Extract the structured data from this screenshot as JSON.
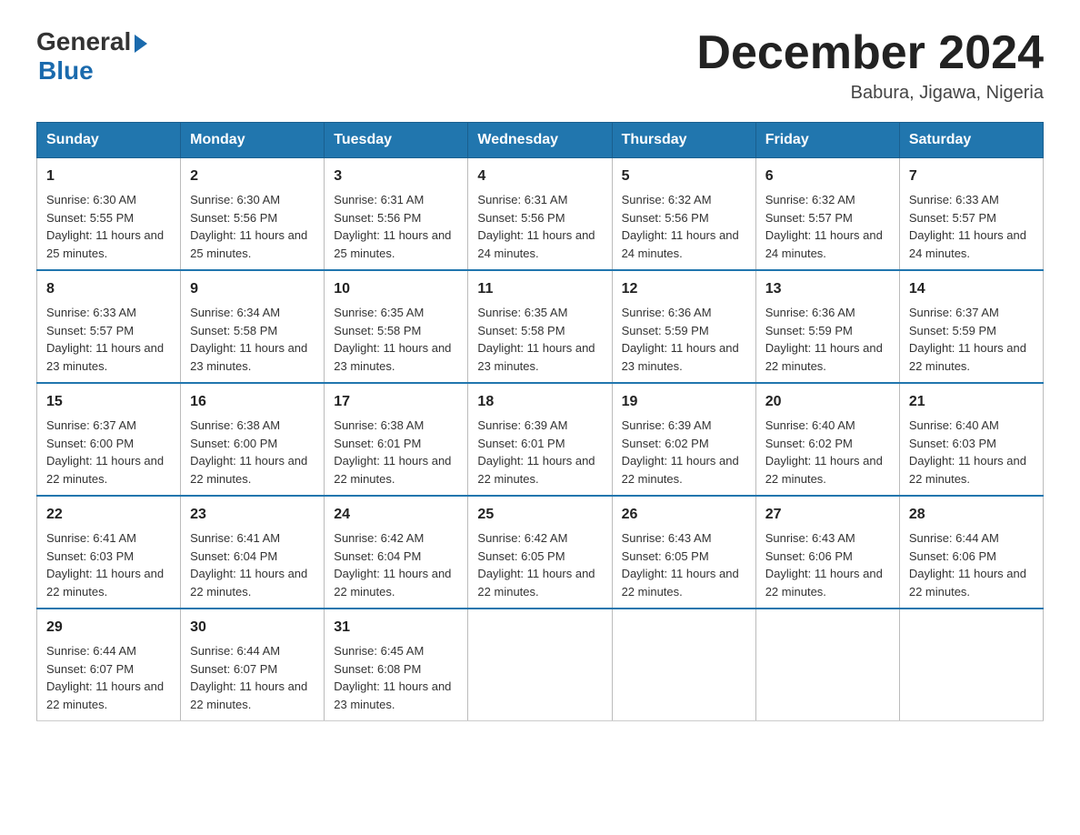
{
  "header": {
    "logo_general": "General",
    "logo_blue": "Blue",
    "month_title": "December 2024",
    "location": "Babura, Jigawa, Nigeria"
  },
  "weekdays": [
    "Sunday",
    "Monday",
    "Tuesday",
    "Wednesday",
    "Thursday",
    "Friday",
    "Saturday"
  ],
  "weeks": [
    [
      {
        "day": "1",
        "sunrise": "6:30 AM",
        "sunset": "5:55 PM",
        "daylight": "11 hours and 25 minutes."
      },
      {
        "day": "2",
        "sunrise": "6:30 AM",
        "sunset": "5:56 PM",
        "daylight": "11 hours and 25 minutes."
      },
      {
        "day": "3",
        "sunrise": "6:31 AM",
        "sunset": "5:56 PM",
        "daylight": "11 hours and 25 minutes."
      },
      {
        "day": "4",
        "sunrise": "6:31 AM",
        "sunset": "5:56 PM",
        "daylight": "11 hours and 24 minutes."
      },
      {
        "day": "5",
        "sunrise": "6:32 AM",
        "sunset": "5:56 PM",
        "daylight": "11 hours and 24 minutes."
      },
      {
        "day": "6",
        "sunrise": "6:32 AM",
        "sunset": "5:57 PM",
        "daylight": "11 hours and 24 minutes."
      },
      {
        "day": "7",
        "sunrise": "6:33 AM",
        "sunset": "5:57 PM",
        "daylight": "11 hours and 24 minutes."
      }
    ],
    [
      {
        "day": "8",
        "sunrise": "6:33 AM",
        "sunset": "5:57 PM",
        "daylight": "11 hours and 23 minutes."
      },
      {
        "day": "9",
        "sunrise": "6:34 AM",
        "sunset": "5:58 PM",
        "daylight": "11 hours and 23 minutes."
      },
      {
        "day": "10",
        "sunrise": "6:35 AM",
        "sunset": "5:58 PM",
        "daylight": "11 hours and 23 minutes."
      },
      {
        "day": "11",
        "sunrise": "6:35 AM",
        "sunset": "5:58 PM",
        "daylight": "11 hours and 23 minutes."
      },
      {
        "day": "12",
        "sunrise": "6:36 AM",
        "sunset": "5:59 PM",
        "daylight": "11 hours and 23 minutes."
      },
      {
        "day": "13",
        "sunrise": "6:36 AM",
        "sunset": "5:59 PM",
        "daylight": "11 hours and 22 minutes."
      },
      {
        "day": "14",
        "sunrise": "6:37 AM",
        "sunset": "5:59 PM",
        "daylight": "11 hours and 22 minutes."
      }
    ],
    [
      {
        "day": "15",
        "sunrise": "6:37 AM",
        "sunset": "6:00 PM",
        "daylight": "11 hours and 22 minutes."
      },
      {
        "day": "16",
        "sunrise": "6:38 AM",
        "sunset": "6:00 PM",
        "daylight": "11 hours and 22 minutes."
      },
      {
        "day": "17",
        "sunrise": "6:38 AM",
        "sunset": "6:01 PM",
        "daylight": "11 hours and 22 minutes."
      },
      {
        "day": "18",
        "sunrise": "6:39 AM",
        "sunset": "6:01 PM",
        "daylight": "11 hours and 22 minutes."
      },
      {
        "day": "19",
        "sunrise": "6:39 AM",
        "sunset": "6:02 PM",
        "daylight": "11 hours and 22 minutes."
      },
      {
        "day": "20",
        "sunrise": "6:40 AM",
        "sunset": "6:02 PM",
        "daylight": "11 hours and 22 minutes."
      },
      {
        "day": "21",
        "sunrise": "6:40 AM",
        "sunset": "6:03 PM",
        "daylight": "11 hours and 22 minutes."
      }
    ],
    [
      {
        "day": "22",
        "sunrise": "6:41 AM",
        "sunset": "6:03 PM",
        "daylight": "11 hours and 22 minutes."
      },
      {
        "day": "23",
        "sunrise": "6:41 AM",
        "sunset": "6:04 PM",
        "daylight": "11 hours and 22 minutes."
      },
      {
        "day": "24",
        "sunrise": "6:42 AM",
        "sunset": "6:04 PM",
        "daylight": "11 hours and 22 minutes."
      },
      {
        "day": "25",
        "sunrise": "6:42 AM",
        "sunset": "6:05 PM",
        "daylight": "11 hours and 22 minutes."
      },
      {
        "day": "26",
        "sunrise": "6:43 AM",
        "sunset": "6:05 PM",
        "daylight": "11 hours and 22 minutes."
      },
      {
        "day": "27",
        "sunrise": "6:43 AM",
        "sunset": "6:06 PM",
        "daylight": "11 hours and 22 minutes."
      },
      {
        "day": "28",
        "sunrise": "6:44 AM",
        "sunset": "6:06 PM",
        "daylight": "11 hours and 22 minutes."
      }
    ],
    [
      {
        "day": "29",
        "sunrise": "6:44 AM",
        "sunset": "6:07 PM",
        "daylight": "11 hours and 22 minutes."
      },
      {
        "day": "30",
        "sunrise": "6:44 AM",
        "sunset": "6:07 PM",
        "daylight": "11 hours and 22 minutes."
      },
      {
        "day": "31",
        "sunrise": "6:45 AM",
        "sunset": "6:08 PM",
        "daylight": "11 hours and 23 minutes."
      },
      null,
      null,
      null,
      null
    ]
  ]
}
